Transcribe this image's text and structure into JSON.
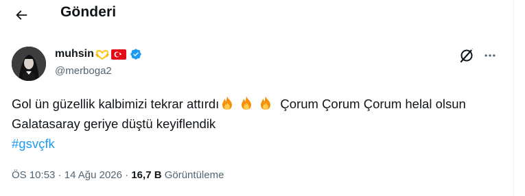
{
  "header": {
    "title": "Gönderi"
  },
  "author": {
    "name": "muhsin",
    "handle": "@merboga2"
  },
  "tweet": {
    "text_part1": "Gol ün güzellik kalbimizi tekrar attırdı",
    "text_part2": " Çorum Çorum Çorum helal olsun Galatasaray geriye düştü keyiflendik",
    "hashtag": "#gsvçfk"
  },
  "meta": {
    "time": "ÖS 10:53",
    "separator1": " · ",
    "date": "14 Ağu 2026",
    "separator2": " · ",
    "views": "16,7 B",
    "views_label": " Görüntüleme"
  },
  "icons": {
    "back": "arrow-left-icon",
    "heart": "yellow-heart-hands-icon",
    "flag": "turkey-flag-icon",
    "verified": "verified-badge-icon",
    "grok": "grok-icon",
    "more": "more-horizontal-icon",
    "fire": "fire-emoji-icon"
  },
  "colors": {
    "accent": "#1d9bf0",
    "text": "#0f1419",
    "secondary": "#536471"
  }
}
